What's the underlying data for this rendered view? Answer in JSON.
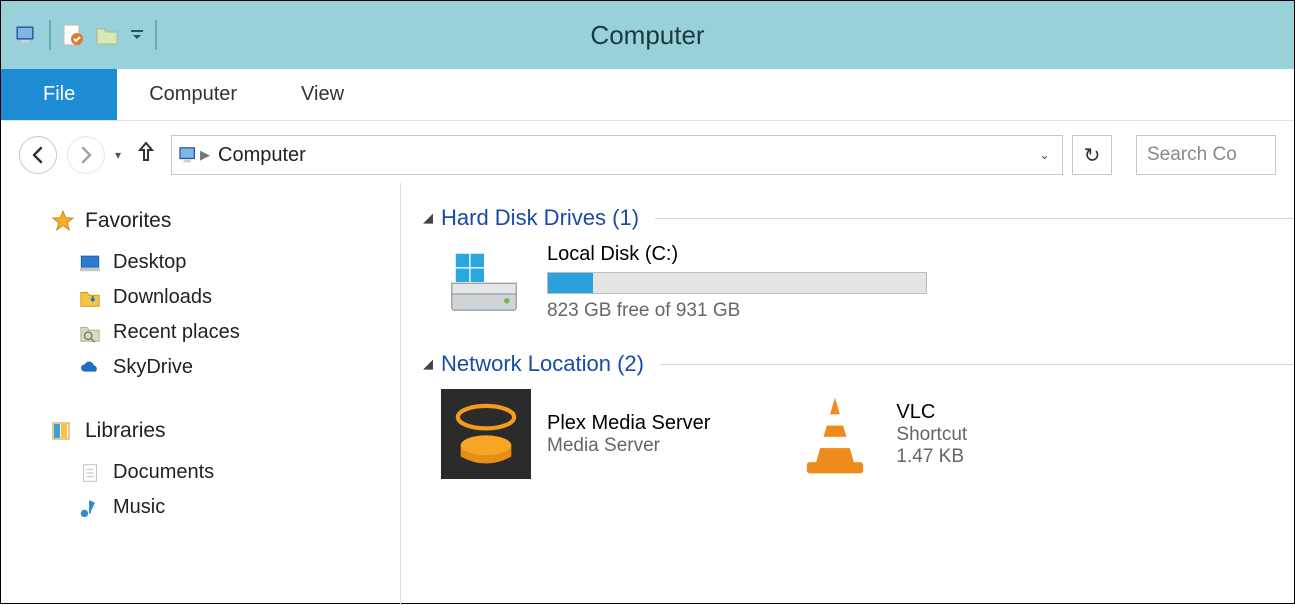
{
  "window": {
    "title": "Computer"
  },
  "ribbon": {
    "file": "File",
    "tabs": [
      "Computer",
      "View"
    ]
  },
  "nav": {
    "crumb": "Computer",
    "search_placeholder": "Search Co"
  },
  "sidebar": {
    "favorites": {
      "label": "Favorites",
      "items": [
        "Desktop",
        "Downloads",
        "Recent places",
        "SkyDrive"
      ]
    },
    "libraries": {
      "label": "Libraries",
      "items": [
        "Documents",
        "Music"
      ]
    }
  },
  "sections": {
    "hdd": {
      "label": "Hard Disk Drives (1)",
      "drive": {
        "name": "Local Disk (C:)",
        "free_text": "823 GB free of 931 GB",
        "fill_percent": 12
      }
    },
    "net": {
      "label": "Network Location (2)",
      "items": [
        {
          "title": "Plex Media Server",
          "sub": "Media Server"
        },
        {
          "title": "VLC",
          "sub": "Shortcut",
          "size": "1.47 KB"
        }
      ]
    }
  }
}
